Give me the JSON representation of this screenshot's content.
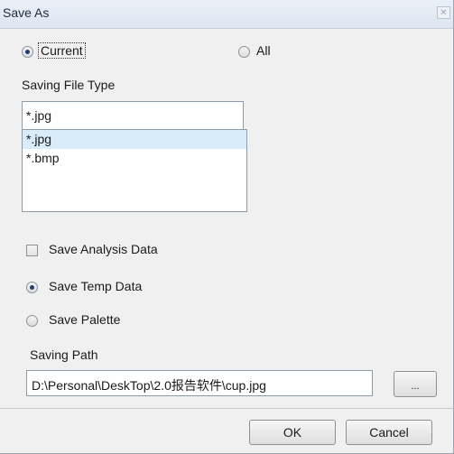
{
  "window": {
    "title": "Save As",
    "close_icon": "close-icon"
  },
  "scope": {
    "options": [
      {
        "label": "Current",
        "selected": true
      },
      {
        "label": "All",
        "selected": false
      }
    ]
  },
  "file_type": {
    "label": "Saving File Type",
    "value": "*.jpg",
    "items": [
      {
        "label": "*.jpg",
        "selected": true
      },
      {
        "label": "*.bmp",
        "selected": false
      }
    ]
  },
  "options": {
    "save_analysis_data": {
      "label": "Save Analysis Data",
      "checked": false
    },
    "save_temp_data": {
      "label": "Save Temp Data",
      "selected": true
    },
    "save_palette": {
      "label": "Save Palette",
      "selected": false
    }
  },
  "path": {
    "label": "Saving Path",
    "value": "D:\\Personal\\DeskTop\\2.0报告软件\\cup.jpg",
    "browse_label": "..."
  },
  "buttons": {
    "ok": "OK",
    "cancel": "Cancel"
  }
}
